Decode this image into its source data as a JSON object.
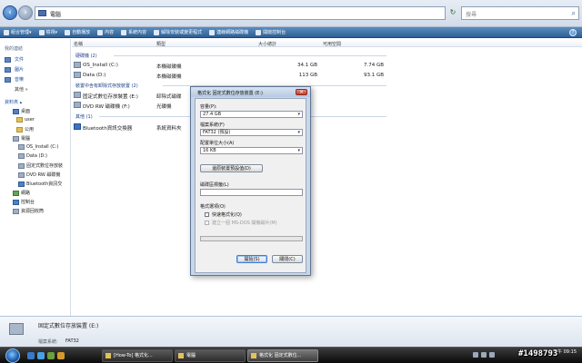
{
  "address": {
    "path": "電腦",
    "search_placeholder": "搜尋"
  },
  "toolbar": {
    "items": [
      "組合管理",
      "檢視",
      "自動播放",
      "內容",
      "系統內容",
      "解除安裝或變更程式",
      "連線網路磁碟機",
      "開啟控制台"
    ]
  },
  "nav": {
    "favorites_header": "我的連結",
    "favorites": [
      "文件",
      "圖片",
      "音樂"
    ],
    "more": "其他 »",
    "folders_header": "資料夾",
    "tree": [
      "桌面",
      "user",
      "公用",
      "電腦",
      "OS_Install (C:)",
      "Data (D:)",
      "固定式數位存放裝",
      "DVD RW 磁碟機",
      "Bluetooth資訊交",
      "網路",
      "控制台",
      "資源回收筒"
    ]
  },
  "list": {
    "columns": {
      "name": "名稱",
      "type": "類型",
      "size": "大小總計",
      "free": "可用空間"
    },
    "groups": [
      "硬碟機 (2)",
      "裝置中含有卸除式存放裝置 (2)",
      "其他 (1)"
    ],
    "rows": [
      {
        "name": "OS_Install (C:)",
        "type": "本機磁碟機",
        "size": "34.1 GB",
        "free": "7.74 GB"
      },
      {
        "name": "Data (D:)",
        "type": "本機磁碟機",
        "size": "113 GB",
        "free": "93.1 GB"
      },
      {
        "name": "固定式數位存放裝置 (E:)",
        "type": "卸除式磁碟",
        "size": "",
        "free": ""
      },
      {
        "name": "DVD RW 磁碟機 (F:)",
        "type": "光碟機",
        "size": "",
        "free": ""
      },
      {
        "name": "Bluetooth資訊交換器",
        "type": "系統資料夾",
        "size": "",
        "free": ""
      }
    ]
  },
  "details": {
    "title": "固定式數位存放裝置 (E:)",
    "fs_label": "檔案系統:",
    "fs_value": "FAT32"
  },
  "dialog": {
    "title": "格式化 固定式數位存放裝置 (E:)",
    "capacity_label": "容量(P):",
    "capacity_value": "27.4 GB",
    "filesystem_label": "檔案系統(F)",
    "filesystem_value": "FAT32 (預設)",
    "alloc_label": "配置單位大小(A)",
    "alloc_value": "16 KB",
    "restore_button": "還原裝置預設值(D)",
    "volume_label": "磁碟區標籤(L)",
    "volume_value": "",
    "options_label": "格式選項(O)",
    "quick_format": "快速格式化(Q)",
    "msdos_disk": "建立一個 MS-DOS 開機磁片(M)",
    "progress": 0,
    "start_button": "開始(S)",
    "close_button": "關閉(C)"
  },
  "taskbar": {
    "tasks": [
      "[How-To] 格式化...",
      "電腦",
      "格式化 固定式數位..."
    ],
    "time": "下午 09:15"
  },
  "watermark": "#1498793"
}
